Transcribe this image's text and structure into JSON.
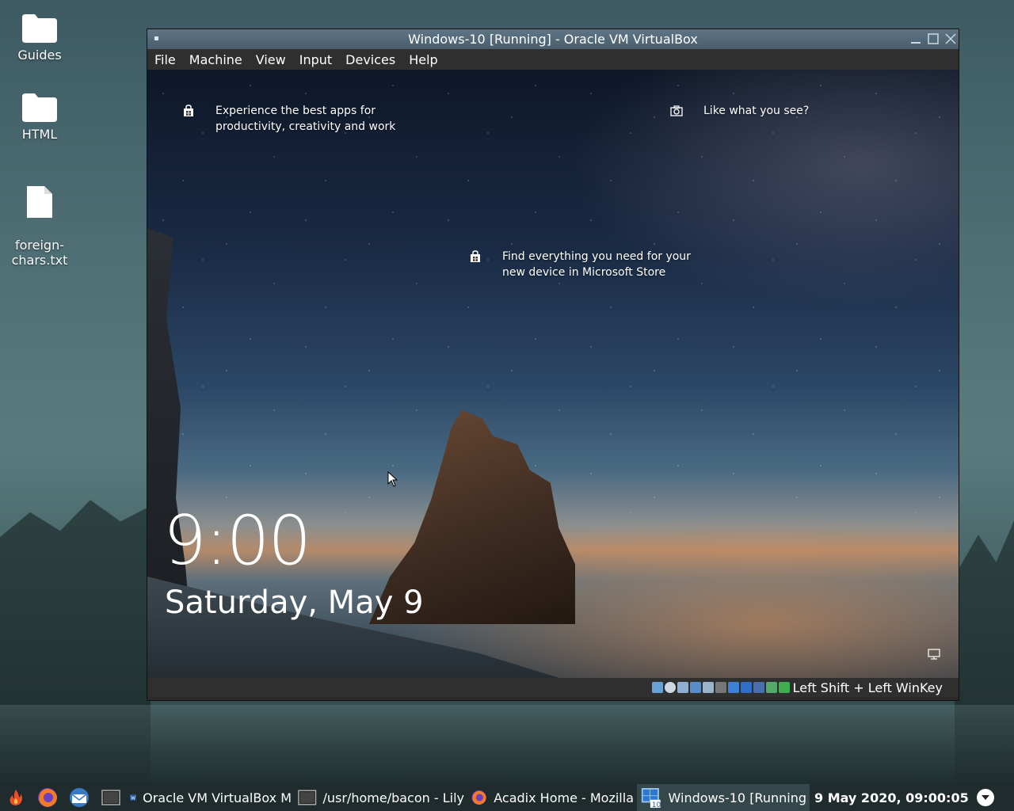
{
  "desktop": {
    "icons": [
      {
        "label": "Guides",
        "icon": "folder-icon"
      },
      {
        "label": "HTML",
        "icon": "folder-icon"
      },
      {
        "label": "foreign-\nchars.txt",
        "icon": "file-icon"
      }
    ]
  },
  "window": {
    "title": "Windows-10 [Running] - Oracle VM VirtualBox",
    "menu": [
      "File",
      "Machine",
      "View",
      "Input",
      "Devices",
      "Help"
    ],
    "status_text": "Left Shift + Left WinKey"
  },
  "guest": {
    "tips": [
      {
        "text": "Experience the best apps for productivity, creativity and work",
        "icon": "store-bag-icon"
      },
      {
        "text": "Like what you see?",
        "icon": "camera-icon"
      },
      {
        "text": "Find everything you need for your new device in Microsoft Store",
        "icon": "store-bag-icon"
      }
    ],
    "time": "9:00",
    "date": "Saturday, May 9"
  },
  "taskbar": {
    "launchers": [
      "fire-icon",
      "firefox-icon",
      "mail-icon",
      "terminal-icon"
    ],
    "tasks": [
      {
        "label": "Oracle VM VirtualBox M",
        "icon": "virtualbox-icon"
      },
      {
        "label": "/usr/home/bacon - Lily",
        "icon": "terminal-icon"
      },
      {
        "label": "Acadix Home - Mozilla",
        "icon": "firefox-icon"
      },
      {
        "label": "Windows-10 [Running",
        "icon": "windows10-vm-icon",
        "active": true
      }
    ],
    "clock": "9 May 2020, 09:00:05"
  },
  "colors": {
    "titlebar": "#5f7585",
    "taskbar": "#1f2b2c"
  }
}
